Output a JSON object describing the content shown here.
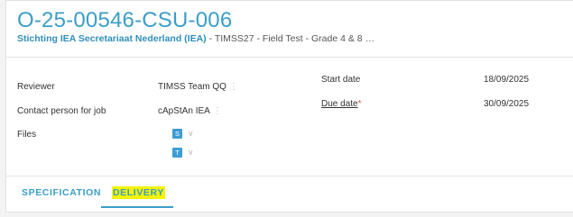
{
  "header": {
    "title": "O-25-00546-CSU-006",
    "org": "Stichting IEA Secretariaat Nederland (IEA)",
    "rest": " - TIMSS27 - Field Test - Grade 4 & 8 …"
  },
  "fields": {
    "reviewer_label": "Reviewer",
    "reviewer_value": "TIMSS Team QQ",
    "contact_label": "Contact person for job",
    "contact_value": "cApStAn IEA",
    "files_label": "Files",
    "file1": "S",
    "file2": "T",
    "start_label": "Start date",
    "start_value": "18/09/2025",
    "due_label": "Due date",
    "due_required": "*",
    "due_value": "30/09/2025"
  },
  "tabs": {
    "specification": "SPECIFICATION",
    "delivery": "DELIVERY"
  },
  "icons": {
    "kebab": "⋮",
    "chevron": "∨"
  },
  "colors": {
    "accent": "#3a9ec9",
    "highlight": "#f4f300",
    "required": "#d9534f"
  }
}
